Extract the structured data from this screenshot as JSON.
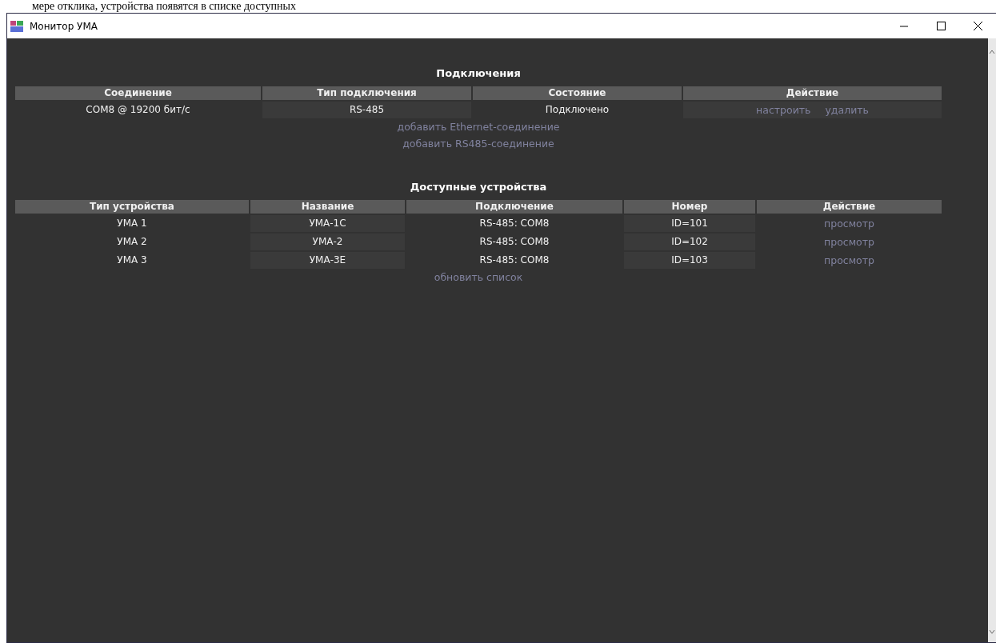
{
  "background_document": {
    "text": "мере отклика, устройства появятся в списке доступных"
  },
  "window": {
    "title": "Монитор УМА"
  },
  "sections": [
    {
      "title": "Подключения",
      "table": {
        "columns": [
          "Соединение",
          "Тип подключения",
          "Состояние",
          "Действие"
        ],
        "rows": [
          {
            "cells": [
              "COM8 @ 19200 бит/с",
              "RS-485",
              "Подключено"
            ],
            "actions": [
              "настроить",
              "удалить"
            ]
          }
        ]
      },
      "links": [
        "добавить Ethernet-соединение",
        "добавить RS485-соединение"
      ]
    },
    {
      "title": "Доступные устройства",
      "table": {
        "columns": [
          "Тип устройства",
          "Название",
          "Подключение",
          "Номер",
          "Действие"
        ],
        "rows": [
          {
            "cells": [
              "УМА 1",
              "УМА-1С",
              "RS-485: COM8",
              "ID=101"
            ],
            "actions": [
              "просмотр"
            ]
          },
          {
            "cells": [
              "УМА 2",
              "УМА-2",
              "RS-485: COM8",
              "ID=102"
            ],
            "actions": [
              "просмотр"
            ]
          },
          {
            "cells": [
              "УМА 3",
              "УМА-3Е",
              "RS-485: COM8",
              "ID=103"
            ],
            "actions": [
              "просмотр"
            ]
          }
        ]
      },
      "links": [
        "обновить список"
      ]
    }
  ]
}
